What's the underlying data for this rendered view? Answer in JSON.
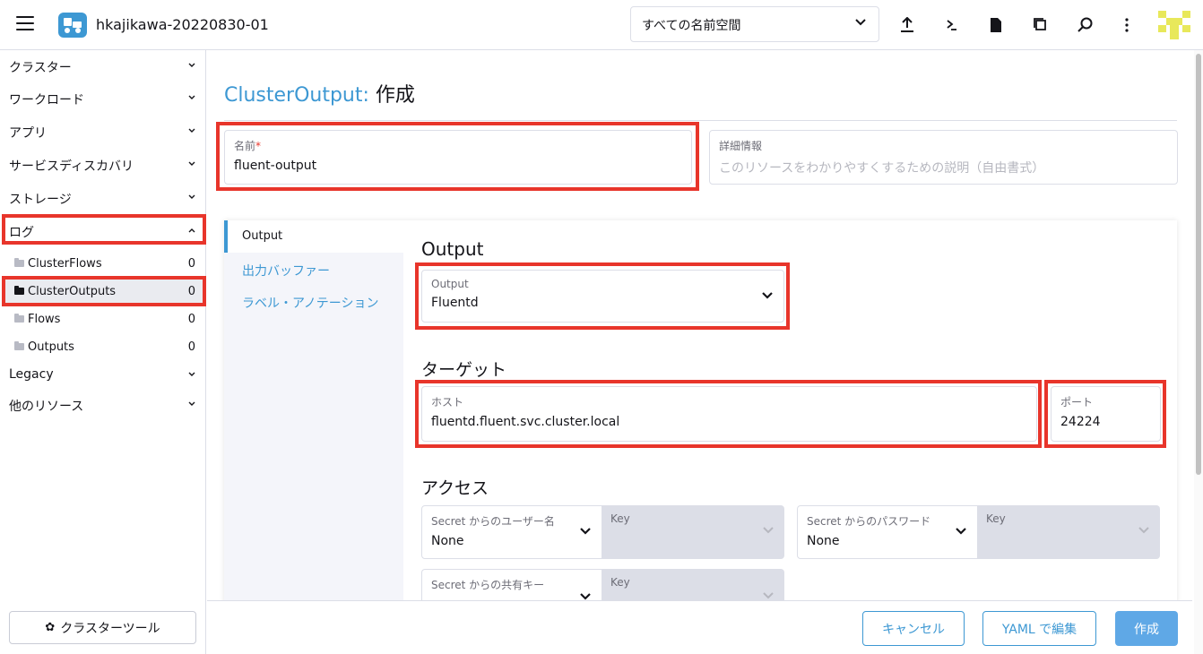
{
  "header": {
    "cluster_name": "hkajikawa-20220830-01",
    "namespace_select": "すべての名前空間",
    "icons": [
      "upload-icon",
      "terminal-icon",
      "file-icon",
      "copy-config-icon",
      "search-icon",
      "more-icon"
    ]
  },
  "sidebar": {
    "groups": [
      {
        "label": "クラスター"
      },
      {
        "label": "ワークロード"
      },
      {
        "label": "アプリ"
      },
      {
        "label": "サービスディスカバリ"
      },
      {
        "label": "ストレージ"
      },
      {
        "label": "ログ"
      },
      {
        "label": "Legacy"
      },
      {
        "label": "他のリソース"
      }
    ],
    "log_items": [
      {
        "label": "ClusterFlows",
        "count": "0"
      },
      {
        "label": "ClusterOutputs",
        "count": "0"
      },
      {
        "label": "Flows",
        "count": "0"
      },
      {
        "label": "Outputs",
        "count": "0"
      }
    ],
    "tools_button": "クラスターツール"
  },
  "page": {
    "title_resource": "ClusterOutput:",
    "title_action": "作成",
    "name_field": {
      "label": "名前",
      "required_mark": "*",
      "value": "fluent-output"
    },
    "description_field": {
      "label": "詳細情報",
      "placeholder": "このリソースをわかりやすくするための説明（自由書式）"
    }
  },
  "tabs": [
    {
      "label": "Output"
    },
    {
      "label": "出力バッファー"
    },
    {
      "label": "ラベル・アノテーション"
    }
  ],
  "output_section": {
    "heading": "Output",
    "output_select": {
      "label": "Output",
      "value": "Fluentd"
    }
  },
  "target_section": {
    "heading": "ターゲット",
    "host": {
      "label": "ホスト",
      "value": "fluentd.fluent.svc.cluster.local"
    },
    "port": {
      "label": "ポート",
      "value": "24224"
    }
  },
  "access_section": {
    "heading": "アクセス",
    "username_secret": {
      "label": "Secret からのユーザー名",
      "value": "None",
      "key_label": "Key"
    },
    "password_secret": {
      "label": "Secret からのパスワード",
      "value": "None",
      "key_label": "Key"
    },
    "shared_key_secret": {
      "label": "Secret からの共有キー",
      "key_label": "Key"
    }
  },
  "footer": {
    "cancel": "キャンセル",
    "yaml_edit": "YAML で編集",
    "create": "作成"
  },
  "colors": {
    "accent": "#3d98d3",
    "highlight": "#e8352b",
    "primary_button": "#5fa8e6"
  }
}
